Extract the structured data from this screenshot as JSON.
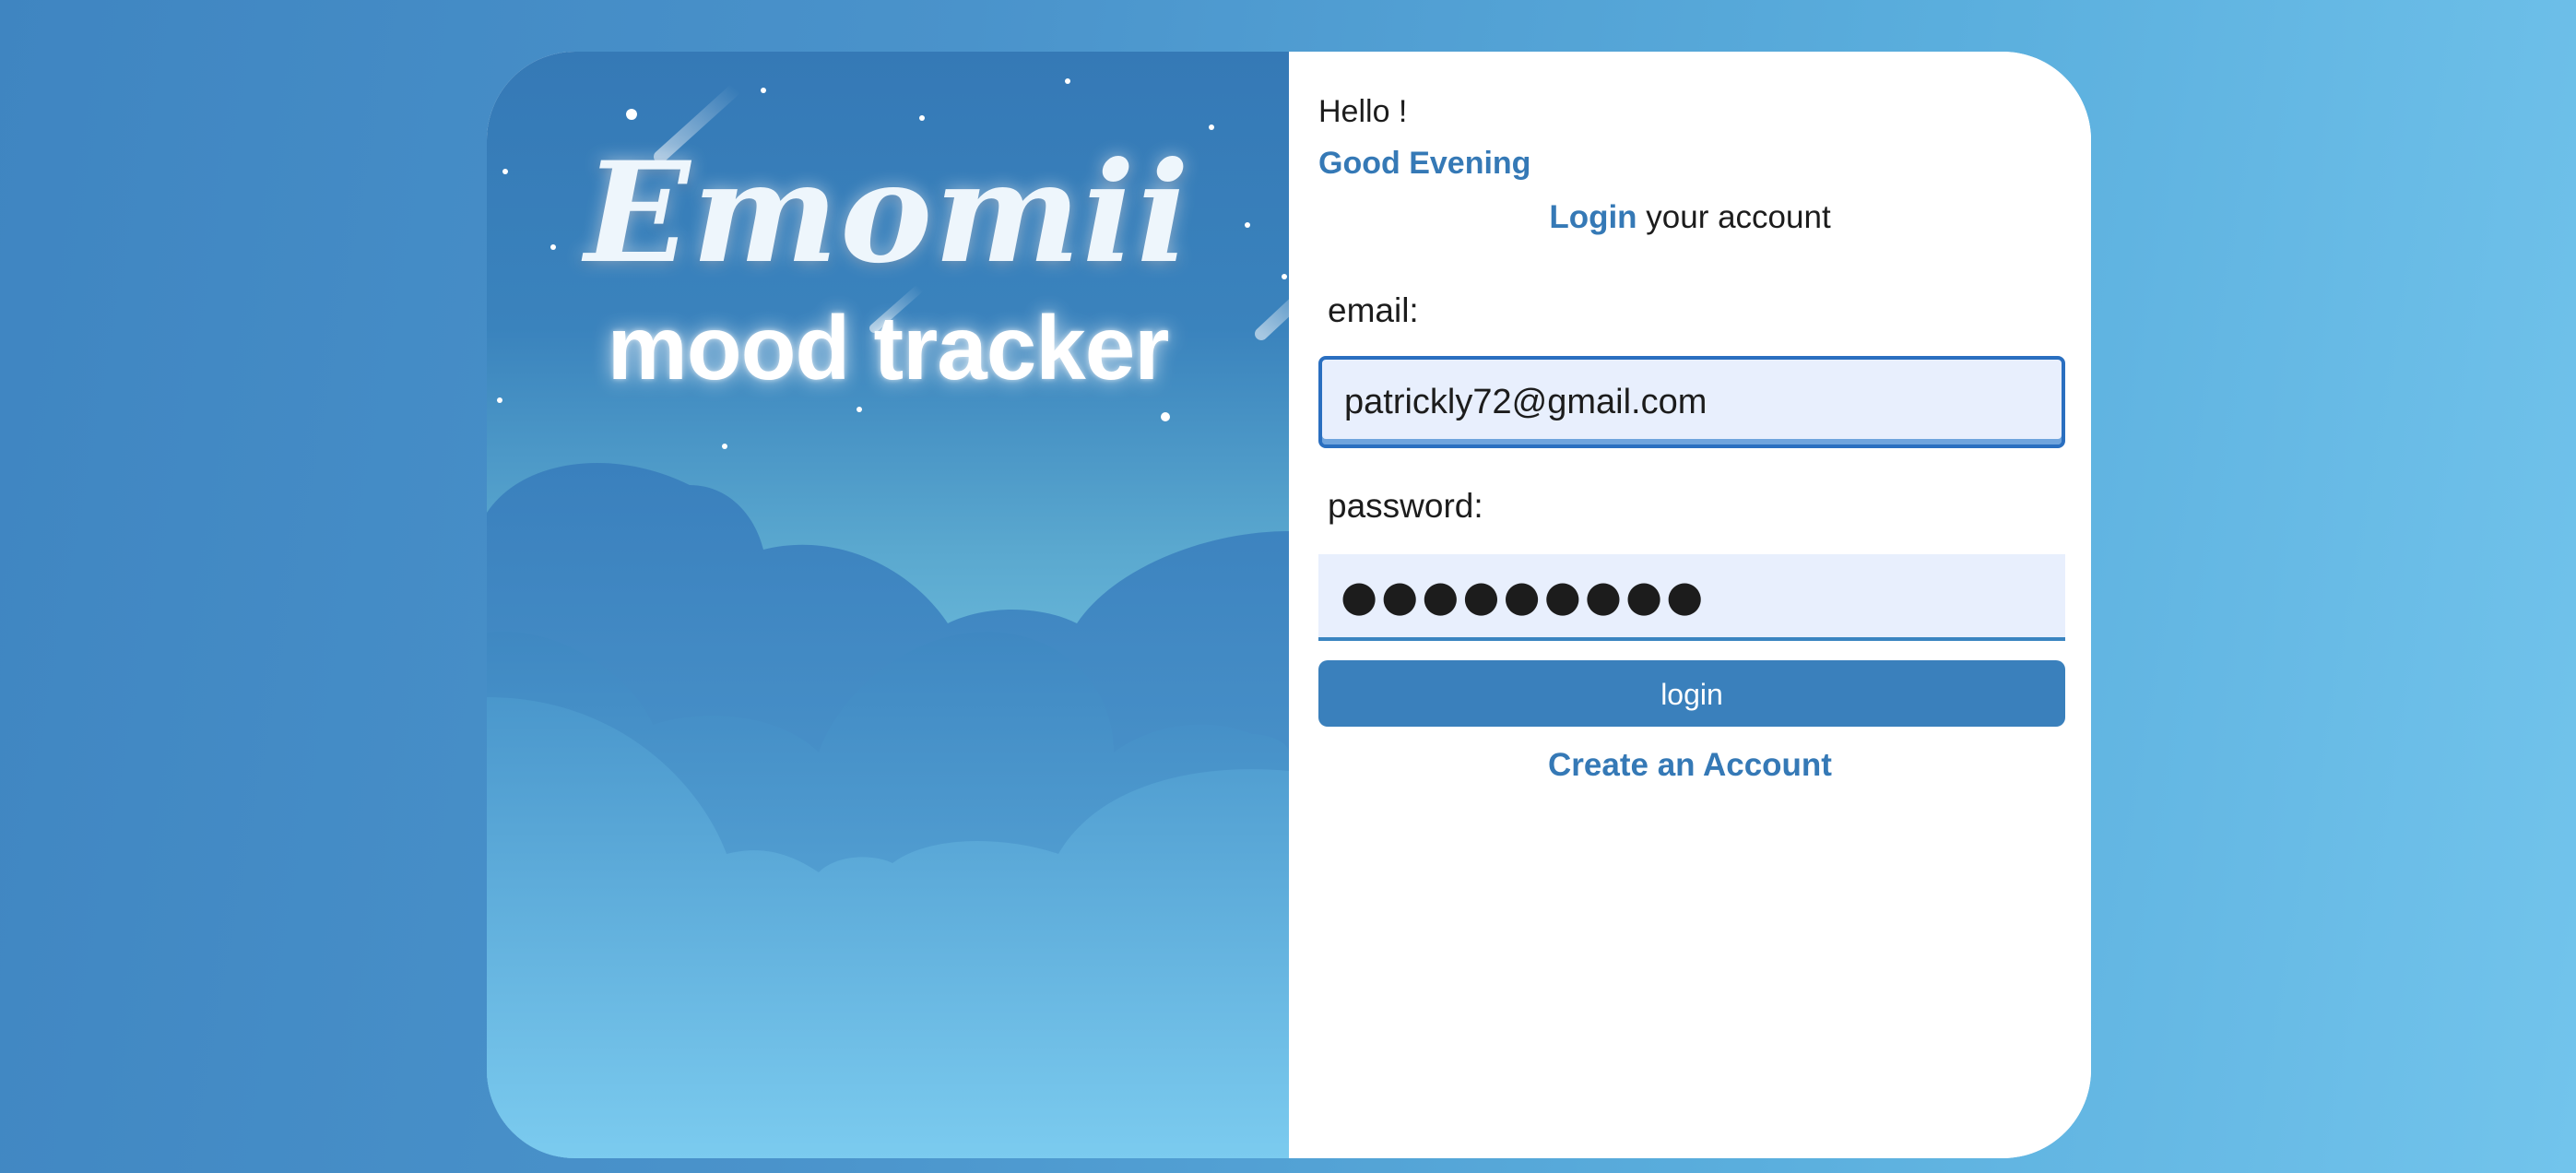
{
  "brand": {
    "name": "Emomii",
    "tagline": "mood tracker"
  },
  "greeting": {
    "hello": "Hello !",
    "time_of_day": "Good Evening"
  },
  "heading": {
    "accent": "Login",
    "rest": " your account"
  },
  "form": {
    "email_label": "email:",
    "email_value": "patrickly72@gmail.com",
    "password_label": "password:",
    "password_masked": "●●●●●●●●●",
    "login_button": "login",
    "create_account_link": "Create an Account"
  },
  "colors": {
    "accent": "#3579b6",
    "button": "#3a80bc",
    "input_bg": "#e8effd",
    "focus_border": "#2a6fc0"
  }
}
